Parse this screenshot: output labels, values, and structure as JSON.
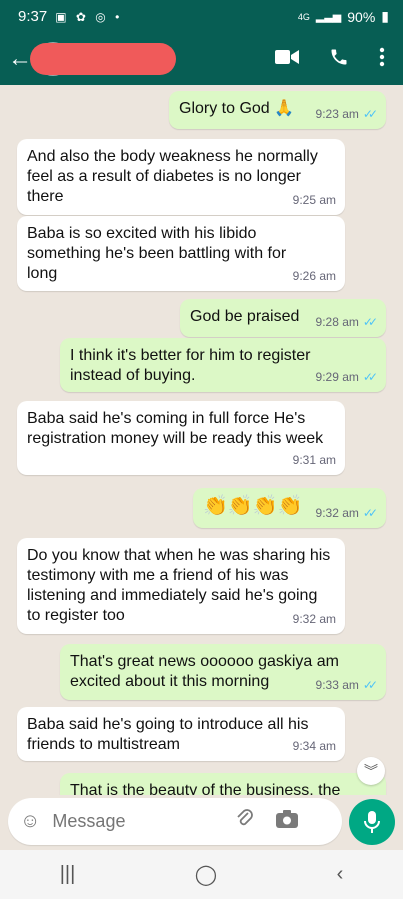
{
  "status": {
    "time": "9:37",
    "network": "4G",
    "battery": "90%"
  },
  "header": {
    "back_icon": "arrow-left-icon",
    "contact_name": "",
    "video_icon": "video-call-icon",
    "call_icon": "phone-icon",
    "menu_icon": "more-vert-icon"
  },
  "messages": [
    {
      "dir": "out",
      "text": "Glory to God 🙏",
      "time": "9:23 am",
      "read": true
    },
    {
      "dir": "in",
      "text": "And also the body weakness he normally feel as a result of diabetes is no longer there",
      "time": "9:25 am"
    },
    {
      "dir": "in",
      "text": "Baba is so excited with his libido something he's been battling with for long",
      "time": "9:26 am"
    },
    {
      "dir": "out",
      "text": "God be praised",
      "time": "9:28 am",
      "read": true
    },
    {
      "dir": "out",
      "text": "I think it's better for him to register instead of buying.",
      "time": "9:29 am",
      "read": true
    },
    {
      "dir": "in",
      "text": "Baba said he's coming in full force He's registration money will be ready this week",
      "time": "9:31 am"
    },
    {
      "dir": "out",
      "text": "👏👏👏👏",
      "time": "9:32 am",
      "read": true
    },
    {
      "dir": "in",
      "text": "Do you know that when he was sharing his testimony with me a friend of his was listening and immediately said he's going to register too",
      "time": "9:32 am"
    },
    {
      "dir": "out",
      "text": "That's great news oooooo gaskiya am excited about it this morning",
      "time": "9:33 am",
      "read": true
    },
    {
      "dir": "in",
      "text": "Baba said he's going to introduce all his friends to multistream",
      "time": "9:34 am"
    },
    {
      "dir": "out",
      "text": "That is the beauty of the business, the",
      "time": "",
      "read": false
    }
  ],
  "composer": {
    "placeholder": "Message"
  }
}
